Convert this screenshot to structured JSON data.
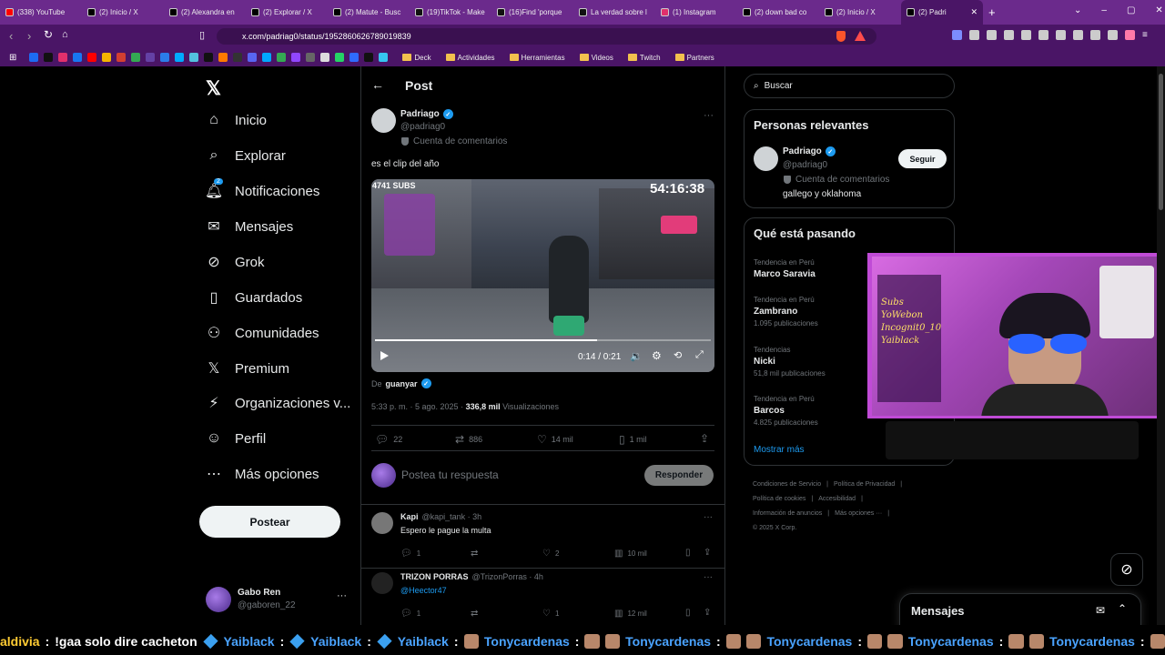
{
  "browser": {
    "tabs": [
      {
        "label": "(338) YouTube",
        "color": "#ff0000"
      },
      {
        "label": "(2) Inicio / X",
        "color": "#000000"
      },
      {
        "label": "(2) Alexandra en",
        "color": "#000000"
      },
      {
        "label": "(2) Explorar / X",
        "color": "#000000"
      },
      {
        "label": "(2) Matute - Busc",
        "color": "#000000"
      },
      {
        "label": "(19)TikTok - Make",
        "color": "#111111"
      },
      {
        "label": "(16)Find 'porque",
        "color": "#111111"
      },
      {
        "label": "La verdad sobre l",
        "color": "#111111"
      },
      {
        "label": "(1) Instagram",
        "color": "#e1306c"
      },
      {
        "label": "(2) down bad co",
        "color": "#000000"
      },
      {
        "label": "(2) Inicio / X",
        "color": "#000000"
      },
      {
        "label": "(2) Padri",
        "color": "#000000"
      }
    ],
    "url": "x.com/padriag0/status/1952860626789019839",
    "bookmarks": [
      "Deck",
      "Actividades",
      "Herramientas",
      "Videos",
      "Twitch",
      "Partners"
    ]
  },
  "sidebar": {
    "items": [
      {
        "label": "Inicio",
        "icon": "home-icon"
      },
      {
        "label": "Explorar",
        "icon": "search-icon"
      },
      {
        "label": "Notificaciones",
        "icon": "bell-icon",
        "badge": "2"
      },
      {
        "label": "Mensajes",
        "icon": "mail-icon"
      },
      {
        "label": "Grok",
        "icon": "grok-icon"
      },
      {
        "label": "Guardados",
        "icon": "bookmark-icon"
      },
      {
        "label": "Comunidades",
        "icon": "people-icon"
      },
      {
        "label": "Premium",
        "icon": "x-icon"
      },
      {
        "label": "Organizaciones v...",
        "icon": "bolt-icon"
      },
      {
        "label": "Perfil",
        "icon": "person-icon"
      },
      {
        "label": "Más opciones",
        "icon": "more-icon"
      }
    ],
    "post_button": "Postear",
    "account": {
      "name": "Gabo Ren",
      "handle": "@gaboren_22"
    }
  },
  "post": {
    "header": "Post",
    "author_name": "Padriago",
    "author_handle": "@padriag0",
    "author_sub": "Cuenta de comentarios",
    "text": "es el clip del año",
    "video": {
      "subs": "4741 SUBS",
      "timer": "54:16:38",
      "time": "0:14 / 0:21",
      "progress": 0.66
    },
    "from_label": "De",
    "from_name": "guanyar",
    "meta_time": "5:33 p. m. · 5 ago. 2025 · ",
    "views_count": "336,8 mil",
    "views_label": " Visualizaciones",
    "stats": {
      "replies": "22",
      "reposts": "886",
      "likes": "14 mil",
      "bookmarks": "1 mil"
    },
    "reply_placeholder": "Postea tu respuesta",
    "reply_button": "Responder"
  },
  "replies": [
    {
      "name": "Kapi",
      "handle": "@kapi_tank · 3h",
      "text": "Espero le pague la multa",
      "replies": "1",
      "reposts": "",
      "likes": "2",
      "views": "10 mil"
    },
    {
      "name": "TRIZON PORRAS",
      "handle": "@TrizonPorras · 4h",
      "text": "@Heector47",
      "replies": "1",
      "reposts": "",
      "likes": "1",
      "views": "12 mil"
    }
  ],
  "right": {
    "search_placeholder": "Buscar",
    "relevant_title": "Personas relevantes",
    "relevant": {
      "name": "Padriago",
      "handle": "@padriag0",
      "sub": "Cuenta de comentarios",
      "bio": "gallego y oklahoma",
      "follow": "Seguir"
    },
    "trends_title": "Qué está pasando",
    "trends": [
      {
        "context": "Tendencia en Perú",
        "name": "Marco Saravia",
        "count": ""
      },
      {
        "context": "Tendencia en Perú",
        "name": "Zambrano",
        "count": "1.095 publicaciones"
      },
      {
        "context": "Tendencias",
        "name": "Nicki",
        "count": "51,8 mil publicaciones"
      },
      {
        "context": "Tendencia en Perú",
        "name": "Barcos",
        "count": "4.825 publicaciones"
      }
    ],
    "show_more": "Mostrar más",
    "footer": [
      "Condiciones de Servicio",
      "Política de Privacidad",
      "Política de cookies",
      "Accesibilidad",
      "Información de anuncios",
      "Más opciones ···",
      "© 2025 X Corp."
    ]
  },
  "messages_drawer": {
    "title": "Mensajes"
  },
  "webcam": {
    "overlay_lines": [
      "Subs",
      "YoWebon",
      "Incognit0_10",
      "Yaiblack"
    ]
  },
  "ticker": {
    "segments": [
      {
        "name": "aldivia",
        "msg": "!gaa solo dire cacheton"
      },
      {
        "name": "Yaiblack",
        "msg": ""
      },
      {
        "name": "Yaiblack",
        "msg": ""
      },
      {
        "name": "Yaiblack",
        "msg": ""
      },
      {
        "name": "Tonycardenas",
        "msg": ""
      },
      {
        "name": "Tonycardenas",
        "msg": ""
      },
      {
        "name": "Tonycardenas",
        "msg": ""
      },
      {
        "name": "Tonycardenas",
        "msg": ""
      },
      {
        "name": "Tonycardenas",
        "msg": ""
      }
    ]
  }
}
